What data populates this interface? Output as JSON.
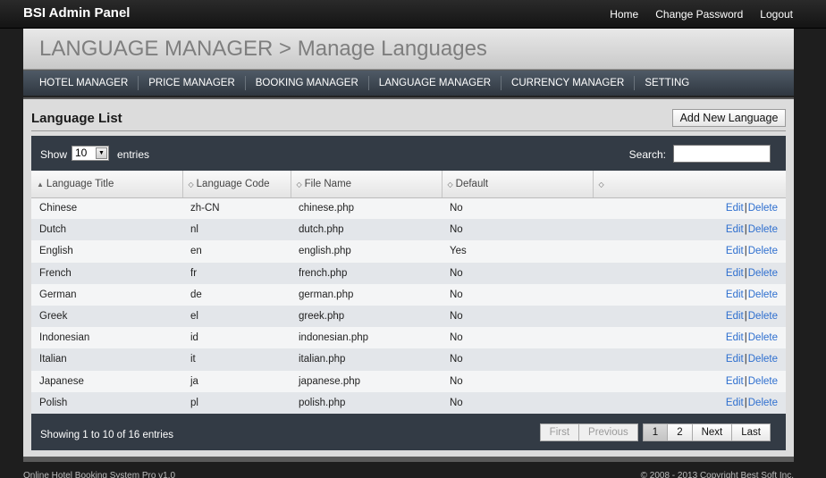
{
  "header": {
    "brand": "BSI Admin Panel",
    "nav": [
      "Home",
      "Change Password",
      "Logout"
    ]
  },
  "page": {
    "title": "LANGUAGE MANAGER > Manage Languages"
  },
  "menu": [
    "HOTEL MANAGER",
    "PRICE MANAGER",
    "BOOKING MANAGER",
    "LANGUAGE MANAGER",
    "CURRENCY MANAGER",
    "SETTING"
  ],
  "section": {
    "title": "Language List",
    "add_button": "Add New Language"
  },
  "controls": {
    "show_label": "Show",
    "page_size": "10",
    "entries_label": "entries",
    "search_label": "Search:",
    "search_value": ""
  },
  "table": {
    "columns": [
      "Language Title",
      "Language Code",
      "File Name",
      "Default",
      ""
    ],
    "rows": [
      [
        "Chinese",
        "zh-CN",
        "chinese.php",
        "No"
      ],
      [
        "Dutch",
        "nl",
        "dutch.php",
        "No"
      ],
      [
        "English",
        "en",
        "english.php",
        "Yes"
      ],
      [
        "French",
        "fr",
        "french.php",
        "No"
      ],
      [
        "German",
        "de",
        "german.php",
        "No"
      ],
      [
        "Greek",
        "el",
        "greek.php",
        "No"
      ],
      [
        "Indonesian",
        "id",
        "indonesian.php",
        "No"
      ],
      [
        "Italian",
        "it",
        "italian.php",
        "No"
      ],
      [
        "Japanese",
        "ja",
        "japanese.php",
        "No"
      ],
      [
        "Polish",
        "pl",
        "polish.php",
        "No"
      ]
    ],
    "edit_label": "Edit",
    "delete_label": "Delete",
    "separator": "|"
  },
  "footer": {
    "info": "Showing 1 to 10 of 16 entries",
    "pager": {
      "first": "First",
      "previous": "Previous",
      "pages": [
        "1",
        "2"
      ],
      "next": "Next",
      "last": "Last"
    }
  },
  "page_footer": {
    "left": "Online Hotel Booking System Pro v1.0",
    "right": "© 2008 - 2013 Copyright Best Soft Inc."
  }
}
